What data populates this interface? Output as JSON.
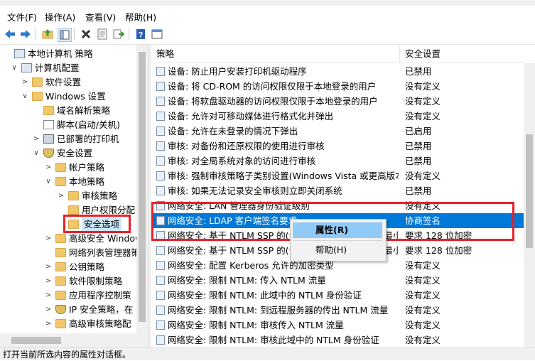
{
  "menu": [
    "文件(F)",
    "操作(A)",
    "查看(V)",
    "帮助(H)"
  ],
  "toolbar_icons": [
    "back-icon",
    "forward-icon",
    "up-folder-icon",
    "show-tree-icon",
    "delete-icon",
    "properties-icon",
    "export-icon",
    "help-icon",
    "console-icon"
  ],
  "tree": [
    {
      "label": "本地计算机 策略",
      "level": 0,
      "toggle": "",
      "icon": "computer"
    },
    {
      "label": "计算机配置",
      "level": 1,
      "toggle": "∨",
      "icon": "computer"
    },
    {
      "label": "软件设置",
      "level": 2,
      "toggle": ">",
      "icon": "folder"
    },
    {
      "label": "Windows 设置",
      "level": 2,
      "toggle": "∨",
      "icon": "folder"
    },
    {
      "label": "域名解析策略",
      "level": 3,
      "toggle": "",
      "icon": "folder"
    },
    {
      "label": "脚本(启动/关机)",
      "level": 3,
      "toggle": "",
      "icon": "doc"
    },
    {
      "label": "已部署的打印机",
      "level": 3,
      "toggle": ">",
      "icon": "printer"
    },
    {
      "label": "安全设置",
      "level": 3,
      "toggle": "∨",
      "icon": "shield"
    },
    {
      "label": "帐户策略",
      "level": 4,
      "toggle": ">",
      "icon": "folder"
    },
    {
      "label": "本地策略",
      "level": 4,
      "toggle": "∨",
      "icon": "folder"
    },
    {
      "label": "审核策略",
      "level": 5,
      "toggle": ">",
      "icon": "folder"
    },
    {
      "label": "用户权限分配",
      "level": 5,
      "toggle": "",
      "icon": "folder"
    },
    {
      "label": "安全选项",
      "level": 5,
      "toggle": "",
      "icon": "folder",
      "selected": true
    },
    {
      "label": "高级安全 Windows",
      "level": 4,
      "toggle": ">",
      "icon": "folder"
    },
    {
      "label": "网络列表管理器策",
      "level": 4,
      "toggle": "",
      "icon": "folder"
    },
    {
      "label": "公钥策略",
      "level": 4,
      "toggle": ">",
      "icon": "folder"
    },
    {
      "label": "软件限制策略",
      "level": 4,
      "toggle": ">",
      "icon": "folder"
    },
    {
      "label": "应用程序控制策",
      "level": 4,
      "toggle": ">",
      "icon": "folder"
    },
    {
      "label": "IP 安全策略，在",
      "level": 4,
      "toggle": ">",
      "icon": "shield"
    },
    {
      "label": "高级审核策略配",
      "level": 4,
      "toggle": ">",
      "icon": "folder"
    }
  ],
  "columns": {
    "policy": "策略",
    "setting": "安全设置"
  },
  "rows": [
    {
      "name": "设备: 防止用户安装打印机驱动程序",
      "setting": "已禁用"
    },
    {
      "name": "设备: 将 CD-ROM 的访问权限仅限于本地登录的用户",
      "setting": "没有定义"
    },
    {
      "name": "设备: 将软盘驱动器的访问权限仅限于本地登录的用户",
      "setting": "没有定义"
    },
    {
      "name": "设备: 允许对可移动媒体进行格式化并弹出",
      "setting": "没有定义"
    },
    {
      "name": "设备: 允许在未登录的情况下弹出",
      "setting": "已启用"
    },
    {
      "name": "审核: 对备份和还原权限的使用进行审核",
      "setting": "已禁用"
    },
    {
      "name": "审核: 对全局系统对象的访问进行审核",
      "setting": "已禁用"
    },
    {
      "name": "审核: 强制审核策略子类别设置(Windows Vista 或更高版本...",
      "setting": "没有定义"
    },
    {
      "name": "审核: 如果无法记录安全审核则立即关闭系统",
      "setting": "已禁用"
    },
    {
      "name": "网络安全: LAN 管理器身份验证级别",
      "setting": "没有定义"
    },
    {
      "name": "网络安全: LDAP 客户端签名要求",
      "setting": "协商签名",
      "selected": true
    },
    {
      "name": "网络安全: 基于 NTLM SSP 的(包括安全 RPC)客户端的最小...",
      "setting": "要求 128 位加密"
    },
    {
      "name": "网络安全: 基于 NTLM SSP 的(包括安全 RPC)服务器的最小...",
      "setting": "要求 128 位加密"
    },
    {
      "name": "网络安全: 配置 Kerberos 允许的加密类型",
      "setting": "没有定义"
    },
    {
      "name": "网络安全: 限制 NTLM: 传入 NTLM 流量",
      "setting": "没有定义"
    },
    {
      "name": "网络安全: 限制 NTLM: 此域中的 NTLM 身份验证",
      "setting": "没有定义"
    },
    {
      "name": "网络安全: 限制 NTLM: 到远程服务器的传出 NTLM 流量",
      "setting": "没有定义"
    },
    {
      "name": "网络安全: 限制 NTLM: 审核传入 NTLM 流量",
      "setting": "没有定义"
    },
    {
      "name": "网络安全: 限制 NTLM: 审核此域中的 NTLM 身份验证",
      "setting": "没有定义"
    }
  ],
  "context_menu": {
    "properties": "属性(R)",
    "help": "帮助(H)"
  },
  "status": "打开当前所选内容的属性对话框。",
  "colors": {
    "selection": "#0078d7",
    "highlight_box": "#e8202a",
    "menu_hover": "#91c9f7"
  }
}
